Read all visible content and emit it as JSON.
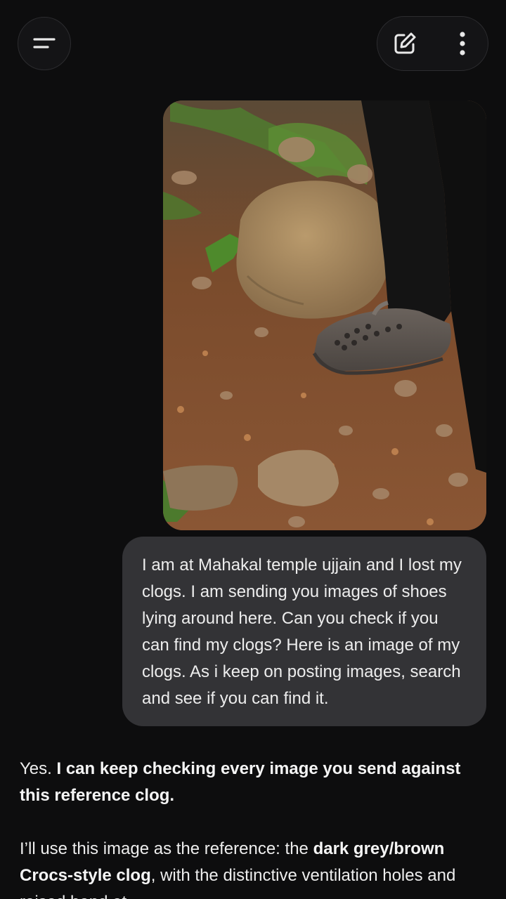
{
  "header": {
    "menu_icon": "menu-icon",
    "edit_icon": "edit-icon",
    "more_icon": "more-vert-icon"
  },
  "user_message": {
    "image": "photo of dark grey clog on rocky ground",
    "text": "I am at Mahakal temple ujjain and I lost my clogs. I am sending you images of shoes lying around here. Can you check if you can find my clogs? Here is an image of my clogs. As i keep on posting images, search and see if you can find it."
  },
  "reply": {
    "p1_plain": "Yes. ",
    "p1_bold": "I can keep checking every image you send against this reference clog.",
    "p2_plain_a": "I’ll use this image as the reference: the ",
    "p2_bold": "dark grey/brown Crocs-style clog",
    "p2_plain_b": ", with the distinctive ventilation holes and raised band at"
  }
}
